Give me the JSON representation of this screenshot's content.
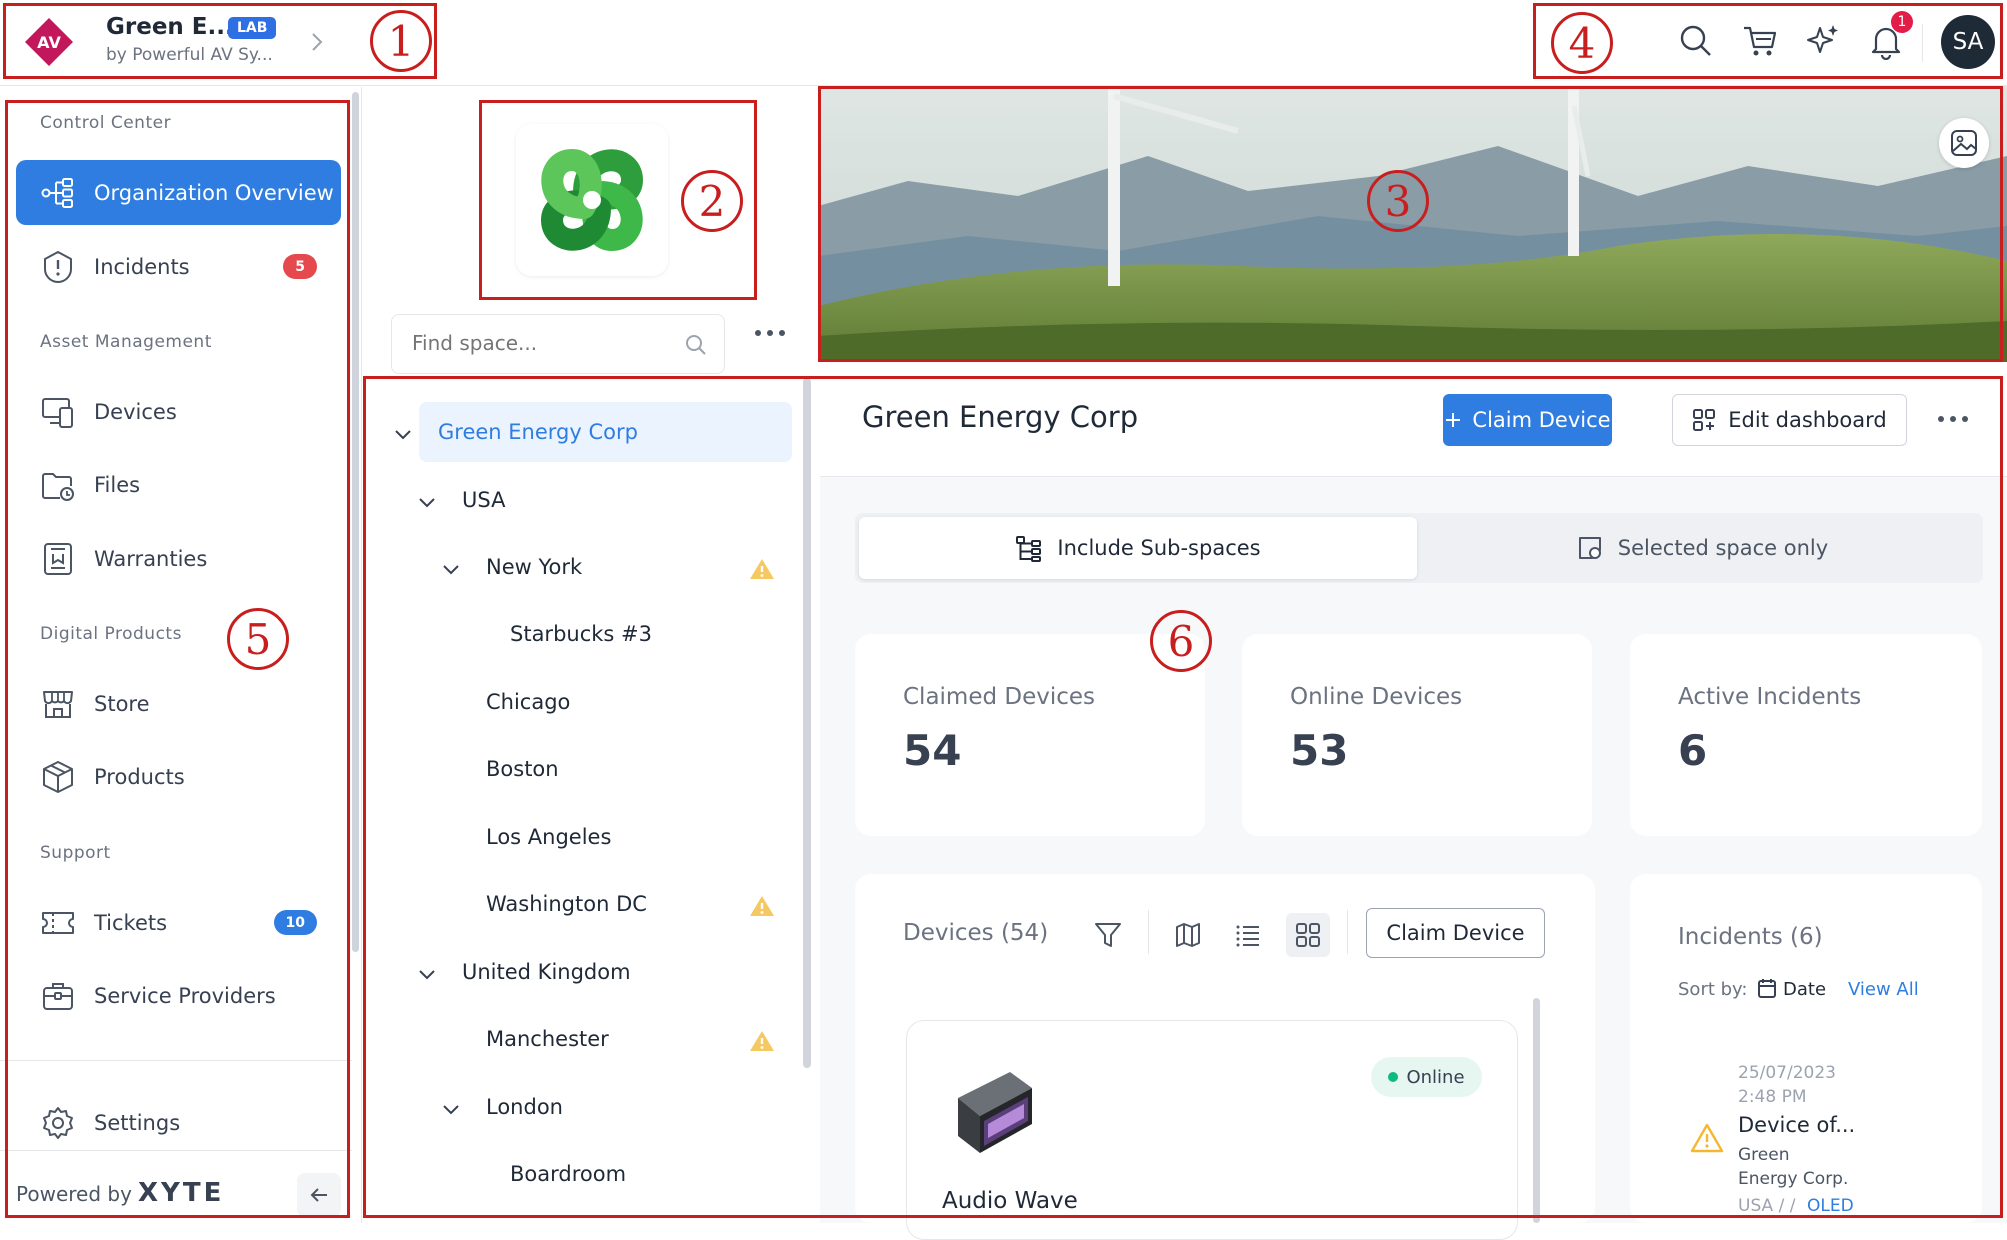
{
  "org": {
    "name": "Green E...",
    "badge": "LAB",
    "subtitle": "by Powerful AV Sy...",
    "logo_text": "AV"
  },
  "topbar": {
    "notification_count": "1",
    "avatar_initials": "SA",
    "icons": [
      "search-icon",
      "cart-icon",
      "sparkles-icon",
      "bell-icon"
    ]
  },
  "sidebar": {
    "sections": {
      "control_center": "Control Center",
      "asset_management": "Asset Management",
      "digital_products": "Digital Products",
      "support": "Support"
    },
    "items": {
      "organization_overview": "Organization Overview",
      "incidents": "Incidents",
      "incidents_badge": "5",
      "devices": "Devices",
      "files": "Files",
      "warranties": "Warranties",
      "store": "Store",
      "products": "Products",
      "tickets": "Tickets",
      "tickets_badge": "10",
      "service_providers": "Service Providers",
      "settings": "Settings"
    },
    "powered_by": "Powered by",
    "brand": "XYTE"
  },
  "spaces": {
    "search_placeholder": "Find space...",
    "tree": {
      "root": "Green Energy Corp",
      "usa": "USA",
      "new_york": "New York",
      "starbucks": "Starbucks #3",
      "chicago": "Chicago",
      "boston": "Boston",
      "los_angeles": "Los Angeles",
      "washington": "Washington DC",
      "uk": "United Kingdom",
      "manchester": "Manchester",
      "london": "London",
      "boardroom": "Boardroom"
    }
  },
  "main": {
    "title": "Green Energy Corp",
    "claim_device": "Claim Device",
    "edit_dashboard": "Edit dashboard",
    "scope": {
      "include": "Include Sub-spaces",
      "selected": "Selected space only"
    },
    "kpis": [
      {
        "label": "Claimed Devices",
        "value": "54"
      },
      {
        "label": "Online Devices",
        "value": "53"
      },
      {
        "label": "Active Incidents",
        "value": "6"
      }
    ],
    "devices_panel": {
      "title": "Devices (54)",
      "claim_button": "Claim Device"
    },
    "device_card": {
      "status": "Online",
      "name": "Audio Wave"
    },
    "incidents_panel": {
      "title": "Incidents (6)",
      "sort_label": "Sort by:",
      "sort_value": "Date",
      "view_all": "View All",
      "item": {
        "date": "25/07/2023",
        "time": "2:48 PM",
        "title": "Device of...",
        "org_line1": "Green",
        "org_line2": "Energy Corp.",
        "path": "USA / / ",
        "path_link": "OLED"
      }
    }
  },
  "annotations": [
    "1",
    "2",
    "3",
    "4",
    "5",
    "6"
  ],
  "colors": {
    "accent": "#2f7de1",
    "annotation": "#c81e1e",
    "badge_red": "#e5484d",
    "badge_blue": "#2f7de1",
    "warning": "#f5b731",
    "online": "#10b981"
  }
}
